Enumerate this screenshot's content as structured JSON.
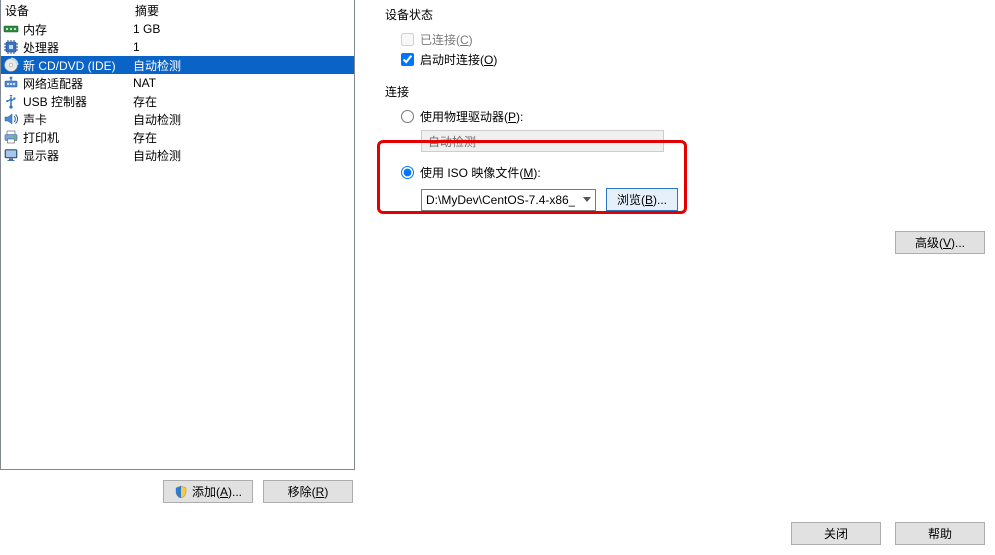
{
  "table": {
    "head_device": "设备",
    "head_summary": "摘要",
    "rows": [
      {
        "icon": "memory-icon",
        "name": "内存",
        "summary": "1 GB",
        "selected": false
      },
      {
        "icon": "cpu-icon",
        "name": "处理器",
        "summary": "1",
        "selected": false
      },
      {
        "icon": "disc-icon",
        "name": "新 CD/DVD (IDE)",
        "summary": "自动检测",
        "selected": true
      },
      {
        "icon": "network-icon",
        "name": "网络适配器",
        "summary": "NAT",
        "selected": false
      },
      {
        "icon": "usb-icon",
        "name": "USB 控制器",
        "summary": "存在",
        "selected": false
      },
      {
        "icon": "sound-icon",
        "name": "声卡",
        "summary": "自动检测",
        "selected": false
      },
      {
        "icon": "printer-icon",
        "name": "打印机",
        "summary": "存在",
        "selected": false
      },
      {
        "icon": "display-icon",
        "name": "显示器",
        "summary": "自动检测",
        "selected": false
      }
    ]
  },
  "buttons": {
    "add": "添加(",
    "add_u": "A",
    "add_suffix": ")...",
    "remove": "移除(",
    "remove_u": "R",
    "remove_suffix": ")"
  },
  "status": {
    "title": "设备状态",
    "connected": "已连接(",
    "connected_u": "C",
    "connected_suffix": ")",
    "on_start": "启动时连接(",
    "on_start_u": "O",
    "on_start_suffix": ")"
  },
  "connect": {
    "title": "连接",
    "use_phys": "使用物理驱动器(",
    "use_phys_u": "P",
    "use_phys_suffix": "):",
    "auto_detect": "自动检测",
    "use_iso": "使用 ISO 映像文件(",
    "use_iso_u": "M",
    "use_iso_suffix": "):",
    "iso_path": "D:\\MyDev\\CentOS-7.4-x86_",
    "browse": "浏览(",
    "browse_u": "B",
    "browse_suffix": ")...",
    "advanced": "高级(",
    "advanced_u": "V",
    "advanced_suffix": ")..."
  },
  "footer": {
    "close": "关闭",
    "help": "帮助"
  }
}
